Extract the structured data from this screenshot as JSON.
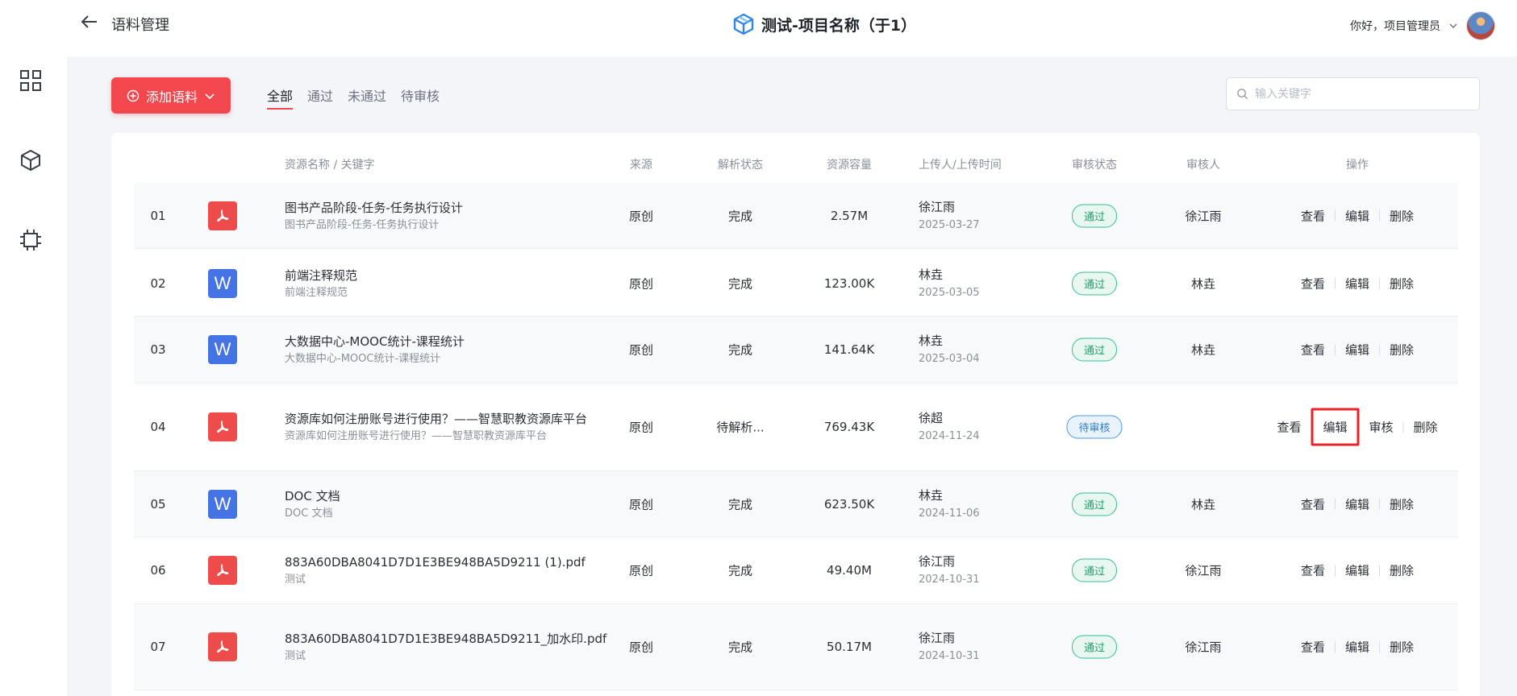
{
  "header": {
    "page_title": "语料管理",
    "project_name": "测试-项目名称（于1）",
    "greeting": "你好，项目管理员"
  },
  "toolbar": {
    "add_label": "添加语料",
    "tabs": [
      {
        "label": "全部",
        "active": true
      },
      {
        "label": "通过",
        "active": false
      },
      {
        "label": "未通过",
        "active": false
      },
      {
        "label": "待审核",
        "active": false
      }
    ],
    "search_placeholder": "输入关键字"
  },
  "table": {
    "columns": {
      "name": "资源名称 / 关键字",
      "source": "来源",
      "parse_status": "解析状态",
      "size": "资源容量",
      "uploader": "上传人/上传时间",
      "review_status": "审核状态",
      "reviewer": "审核人",
      "actions": "操作"
    },
    "action_labels": {
      "view": "查看",
      "edit": "编辑",
      "review": "审核",
      "delete": "删除"
    },
    "rows": [
      {
        "index": "01",
        "type": "pdf",
        "name": "图书产品阶段-任务-任务执行设计",
        "keyword": "图书产品阶段-任务-任务执行设计",
        "source": "原创",
        "parse_status": "完成",
        "size": "2.57M",
        "uploader": "徐江雨",
        "upload_time": "2025-03-27",
        "review_status": "通过",
        "reviewer": "徐江雨"
      },
      {
        "index": "02",
        "type": "doc",
        "type_glyph": "W",
        "name": "前端注释规范",
        "keyword": "前端注释规范",
        "source": "原创",
        "parse_status": "完成",
        "size": "123.00K",
        "uploader": "林垚",
        "upload_time": "2025-03-05",
        "review_status": "通过",
        "reviewer": "林垚"
      },
      {
        "index": "03",
        "type": "doc",
        "type_glyph": "W",
        "name": "大数据中心-MOOC统计-课程统计",
        "keyword": "大数据中心-MOOC统计-课程统计",
        "source": "原创",
        "parse_status": "完成",
        "size": "141.64K",
        "uploader": "林垚",
        "upload_time": "2025-03-04",
        "review_status": "通过",
        "reviewer": "林垚"
      },
      {
        "index": "04",
        "type": "pdf",
        "name": "资源库如何注册账号进行使用？——智慧职教资源库平台",
        "keyword": "资源库如何注册账号进行使用？——智慧职教资源库平台",
        "source": "原创",
        "parse_status": "待解析...",
        "size": "769.43K",
        "uploader": "徐超",
        "upload_time": "2024-11-24",
        "review_status": "待审核",
        "reviewer": ""
      },
      {
        "index": "05",
        "type": "doc",
        "type_glyph": "W",
        "name": "DOC 文档",
        "keyword": "DOC 文档",
        "source": "原创",
        "parse_status": "完成",
        "size": "623.50K",
        "uploader": "林垚",
        "upload_time": "2024-11-06",
        "review_status": "通过",
        "reviewer": "林垚"
      },
      {
        "index": "06",
        "type": "pdf",
        "name": "883A60DBA8041D7D1E3BE948BA5D9211 (1).pdf",
        "keyword": "测试",
        "source": "原创",
        "parse_status": "完成",
        "size": "49.40M",
        "uploader": "徐江雨",
        "upload_time": "2024-10-31",
        "review_status": "通过",
        "reviewer": "徐江雨"
      },
      {
        "index": "07",
        "type": "pdf",
        "name": "883A60DBA8041D7D1E3BE948BA5D9211_加水印.pdf",
        "keyword": "测试",
        "source": "原创",
        "parse_status": "完成",
        "size": "50.17M",
        "uploader": "徐江雨",
        "upload_time": "2024-10-31",
        "review_status": "通过",
        "reviewer": "徐江雨"
      }
    ]
  }
}
